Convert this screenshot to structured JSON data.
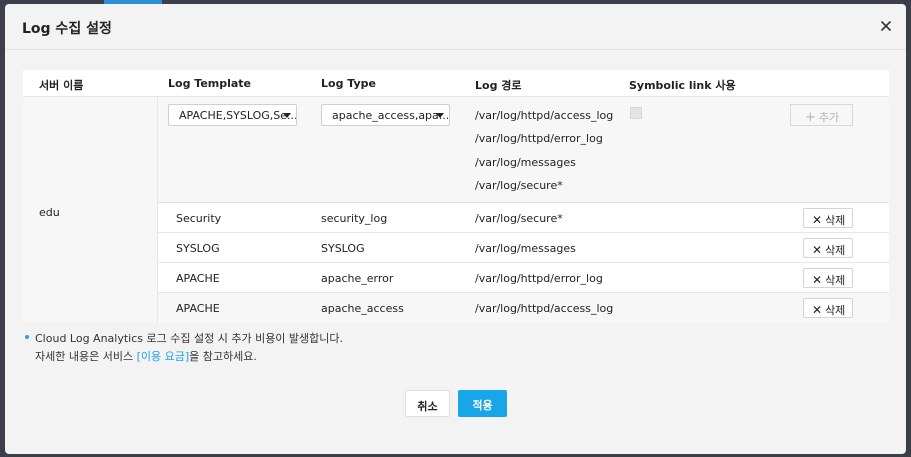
{
  "dialog": {
    "title": "Log 수집 설정",
    "close_icon": "close-icon"
  },
  "table": {
    "headers": [
      "서버 이름",
      "Log Template",
      "Log Type",
      "Log 경로",
      "Symbolic link 사용"
    ],
    "server_name": "edu",
    "add_row": {
      "template_value": "APACHE,SYSLOG,Se...",
      "type_value": "apache_access,apa...",
      "paths": [
        "/var/log/httpd/access_log",
        "/var/log/httpd/error_log",
        "/var/log/messages",
        "/var/log/secure*"
      ],
      "symbolic_link_checked": false,
      "add_label": "추가"
    },
    "rows": [
      {
        "template": "Security",
        "type": "security_log",
        "path": "/var/log/secure*"
      },
      {
        "template": "SYSLOG",
        "type": "SYSLOG",
        "path": "/var/log/messages"
      },
      {
        "template": "APACHE",
        "type": "apache_error",
        "path": "/var/log/httpd/error_log"
      },
      {
        "template": "APACHE",
        "type": "apache_access",
        "path": "/var/log/httpd/access_log"
      }
    ],
    "delete_label": "삭제"
  },
  "notice": {
    "line1": "Cloud Log Analytics 로그 수집 설정 시 추가 비용이 발생합니다.",
    "line2_prefix": "자세한 내용은 서비스 ",
    "line2_link": "[이용 요금]",
    "line2_suffix": "을 참고하세요."
  },
  "footer": {
    "cancel_label": "취소",
    "apply_label": "적용"
  },
  "colors": {
    "accent": "#18a6e8",
    "link": "#1ea5e6"
  }
}
